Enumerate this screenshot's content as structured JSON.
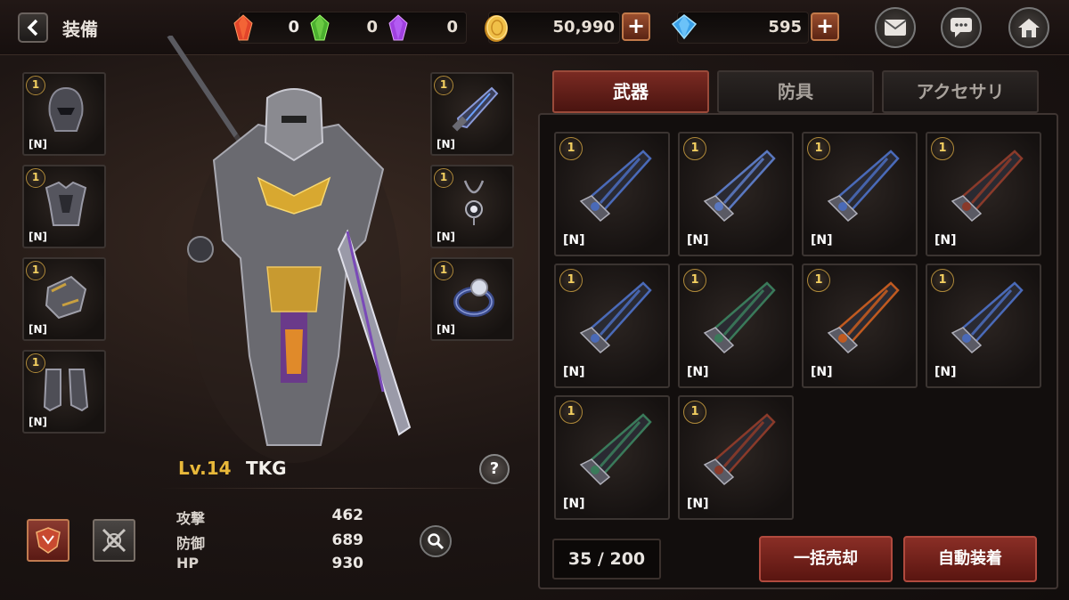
{
  "header": {
    "title": "装備"
  },
  "resources": {
    "red_gem": "0",
    "green_gem": "0",
    "purple_gem": "0",
    "gold": "50,990",
    "diamond": "595"
  },
  "equip_left": [
    {
      "level": "1",
      "grade": "[N]",
      "icon": "helmet-icon"
    },
    {
      "level": "1",
      "grade": "[N]",
      "icon": "chest-armor-icon"
    },
    {
      "level": "1",
      "grade": "[N]",
      "icon": "gauntlet-icon"
    },
    {
      "level": "1",
      "grade": "[N]",
      "icon": "boots-icon"
    }
  ],
  "equip_right": [
    {
      "level": "1",
      "grade": "[N]",
      "icon": "weapon-icon"
    },
    {
      "level": "1",
      "grade": "[N]",
      "icon": "necklace-icon"
    },
    {
      "level": "1",
      "grade": "[N]",
      "icon": "ring-icon"
    }
  ],
  "character": {
    "level": "Lv.14",
    "name": "TKG",
    "help_label": "?",
    "stats": [
      {
        "label": "攻撃",
        "value": "462"
      },
      {
        "label": "防御",
        "value": "689"
      },
      {
        "label": "HP",
        "value": "930"
      }
    ]
  },
  "tabs": [
    {
      "label": "武器",
      "active": true
    },
    {
      "label": "防具",
      "active": false
    },
    {
      "label": "アクセサリ",
      "active": false
    }
  ],
  "inventory": {
    "items": [
      {
        "level": "1",
        "grade": "[N]",
        "color": "#4a6ab8"
      },
      {
        "level": "1",
        "grade": "[N]",
        "color": "#5a78c0"
      },
      {
        "level": "1",
        "grade": "[N]",
        "color": "#4a6ab8"
      },
      {
        "level": "1",
        "grade": "[N]",
        "color": "#8a3a2a"
      },
      {
        "level": "1",
        "grade": "[N]",
        "color": "#4a6ab8"
      },
      {
        "level": "1",
        "grade": "[N]",
        "color": "#3a7a5a"
      },
      {
        "level": "1",
        "grade": "[N]",
        "color": "#c05a20"
      },
      {
        "level": "1",
        "grade": "[N]",
        "color": "#4a6ab8"
      },
      {
        "level": "1",
        "grade": "[N]",
        "color": "#3a7a5a"
      },
      {
        "level": "1",
        "grade": "[N]",
        "color": "#8a3a2a"
      }
    ],
    "count": "35 / 200",
    "sell_all_label": "一括売却",
    "auto_equip_label": "自動装着"
  },
  "colors": {
    "accent_red": "#8a2e26",
    "gold_text": "#e8b83a"
  }
}
